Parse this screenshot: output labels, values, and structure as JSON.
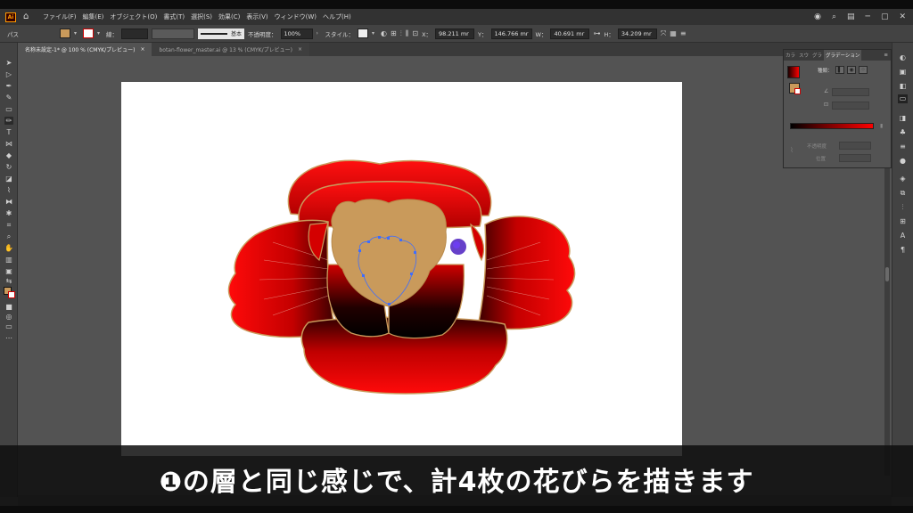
{
  "menubar": {
    "logo": "Ai",
    "items": [
      "ファイル(F)",
      "編集(E)",
      "オブジェクト(O)",
      "書式(T)",
      "選択(S)",
      "効果(C)",
      "表示(V)",
      "ウィンドウ(W)",
      "ヘルプ(H)"
    ]
  },
  "controlbar": {
    "selection_label": "パス",
    "stroke_label": "線：",
    "stroke_style": "基本",
    "opacity_label": "不透明度：",
    "opacity_value": "100%",
    "style_label": "スタイル：",
    "x_label": "X：",
    "x_value": "98.211 mr",
    "y_label": "Y：",
    "y_value": "146.766 mr",
    "w_label": "W：",
    "w_value": "40.691 mr",
    "h_label": "H：",
    "h_value": "34.209 mr"
  },
  "tabs": [
    {
      "label": "名称未設定-1* @ 100 % (CMYK/プレビュー)",
      "close": "×"
    },
    {
      "label": "botan-flower_master.ai @ 13 % (CMYK/プレビュー)",
      "close": "×"
    }
  ],
  "gradient_panel": {
    "tabs": [
      "カラ",
      "スウ",
      "グラ",
      "グラデーション"
    ],
    "type_label": "種類：",
    "opacity_label": "不透明度",
    "location_label": "位置"
  },
  "colors": {
    "fill_gold": "#c99a5b",
    "petal_red": "#e10000",
    "petal_dark": "#2a0000",
    "outline": "#c99a5b",
    "anchor_blue": "#3d6dff"
  },
  "caption": {
    "text": "❶の層と同じ感じで、計4枚の花びらを描きます"
  }
}
